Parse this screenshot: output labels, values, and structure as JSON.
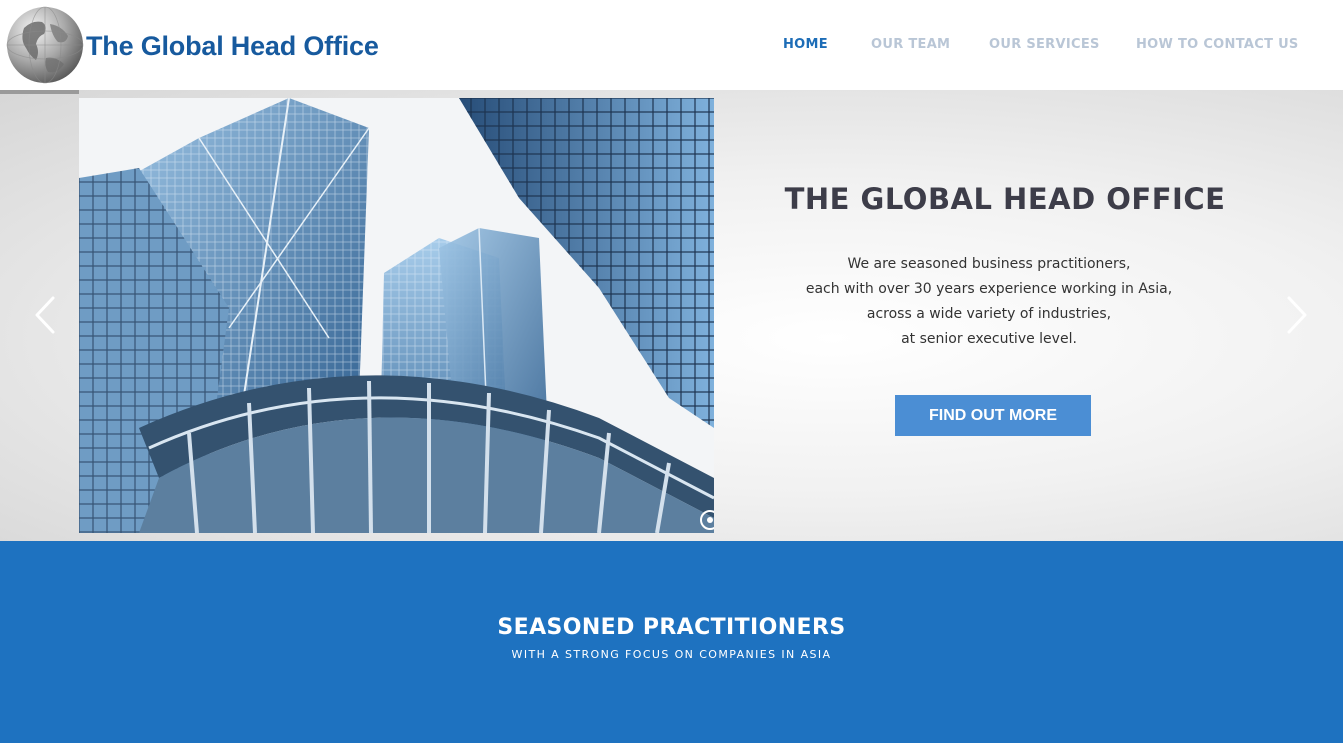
{
  "header": {
    "logo_text": "The Global Head Office",
    "nav": [
      {
        "label": "HOME",
        "active": true
      },
      {
        "label": "OUR TEAM",
        "active": false
      },
      {
        "label": "OUR SERVICES",
        "active": false
      },
      {
        "label": "HOW TO CONTACT US",
        "active": false
      }
    ]
  },
  "hero": {
    "title": "THE GLOBAL HEAD OFFICE",
    "lines": [
      "We are seasoned business practitioners,",
      "each with over 30 years experience working in Asia,",
      "across a wide variety of industries,",
      "at senior executive level."
    ],
    "cta_label": "FIND OUT MORE",
    "prev_icon": "chevron-left-icon",
    "next_icon": "chevron-right-icon"
  },
  "band": {
    "title": "SEASONED PRACTITIONERS",
    "subtitle": "WITH A STRONG FOCUS ON COMPANIES IN ASIA"
  },
  "colors": {
    "brand_blue": "#1e72c0",
    "logo_blue": "#175a9e",
    "button_blue": "#4b8ed4",
    "nav_inactive": "#b9c6d6",
    "title_dark": "#3d3d49"
  }
}
